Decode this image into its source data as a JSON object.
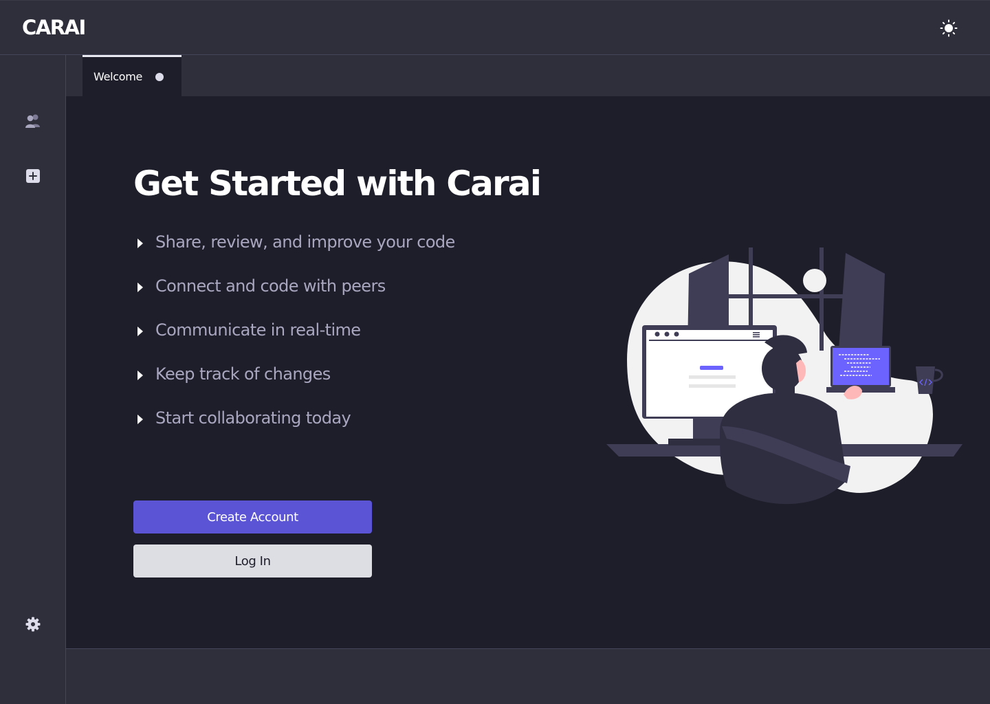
{
  "app": {
    "logo": "CARAI"
  },
  "header": {
    "theme_toggle_icon": "sun-icon"
  },
  "sidebar": {
    "items": [
      {
        "icon": "users-icon"
      },
      {
        "icon": "plus-square-icon"
      },
      {
        "icon": "gear-icon"
      }
    ]
  },
  "tabs": [
    {
      "label": "Welcome",
      "active": true,
      "status": "unsaved-dot"
    }
  ],
  "main": {
    "title": "Get Started with Carai",
    "features": [
      "Share, review, and improve your code",
      "Connect and code with peers",
      "Communicate in real-time",
      "Keep track of changes",
      "Start collaborating today"
    ],
    "primary_button": "Create Account",
    "secondary_button": "Log In"
  },
  "colors": {
    "background": "#1e1e2a",
    "chrome": "#2f2f3b",
    "accent": "#5b55d6",
    "feature_text": "#a9a6c0"
  }
}
